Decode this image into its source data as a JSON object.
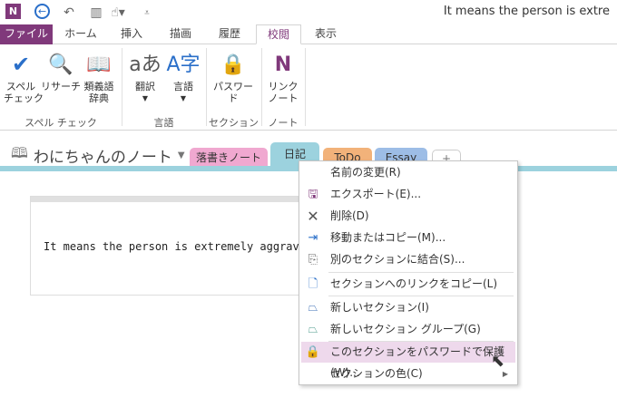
{
  "window": {
    "title": "It means the person is extre"
  },
  "qat": {
    "icons": [
      "onenote-logo-icon",
      "back-icon",
      "undo-icon",
      "dock-icon",
      "touch-mode-icon",
      "customize-icon"
    ]
  },
  "tabs": [
    "ファイル",
    "ホーム",
    "挿入",
    "描画",
    "履歴",
    "校閲",
    "表示"
  ],
  "ribbon": {
    "buttons": [
      {
        "label": "スペル\nチェック",
        "icon": "spell-check-icon"
      },
      {
        "label": "リサーチ",
        "icon": "research-icon"
      },
      {
        "label": "類義語\n辞典",
        "icon": "thesaurus-icon"
      },
      {
        "label": "翻訳",
        "icon": "translate-icon"
      },
      {
        "label": "言語",
        "icon": "language-icon"
      },
      {
        "label": "パスワード",
        "icon": "lock-icon"
      },
      {
        "label": "リンク\nノート",
        "icon": "linked-notes-icon"
      }
    ],
    "groups": [
      "スペル チェック",
      "言語",
      "セクション",
      "ノート"
    ]
  },
  "notebook": {
    "name": "わにちゃんのノート"
  },
  "sections": [
    {
      "label": "落書きノート",
      "color": "#f0a8d0"
    },
    {
      "label": "日記",
      "color": "#9cd2de"
    },
    {
      "label": "ToDo",
      "color": "#f2b27a"
    },
    {
      "label": "Essay",
      "color": "#9dbde6"
    },
    {
      "label": "+"
    }
  ],
  "page": {
    "text": "It means the person is extremely aggrava",
    "handle": "::::"
  },
  "menu": [
    {
      "label": "名前の変更(R)",
      "icon": ""
    },
    {
      "label": "エクスポート(E)...",
      "icon": "export-icon"
    },
    {
      "label": "削除(D)",
      "icon": "delete-icon"
    },
    {
      "label": "移動またはコピー(M)...",
      "icon": "move-copy-icon"
    },
    {
      "label": "別のセクションに結合(S)...",
      "icon": "merge-icon"
    },
    {
      "label": "セクションへのリンクをコピー(L)",
      "icon": "copy-link-icon"
    },
    {
      "label": "新しいセクション(I)",
      "icon": "new-section-icon"
    },
    {
      "label": "新しいセクション グループ(G)",
      "icon": "new-section-group-icon"
    },
    {
      "label": "このセクションをパスワードで保護(W)...",
      "icon": "lock-icon"
    },
    {
      "label": "セクションの色(C)",
      "icon": ""
    }
  ]
}
